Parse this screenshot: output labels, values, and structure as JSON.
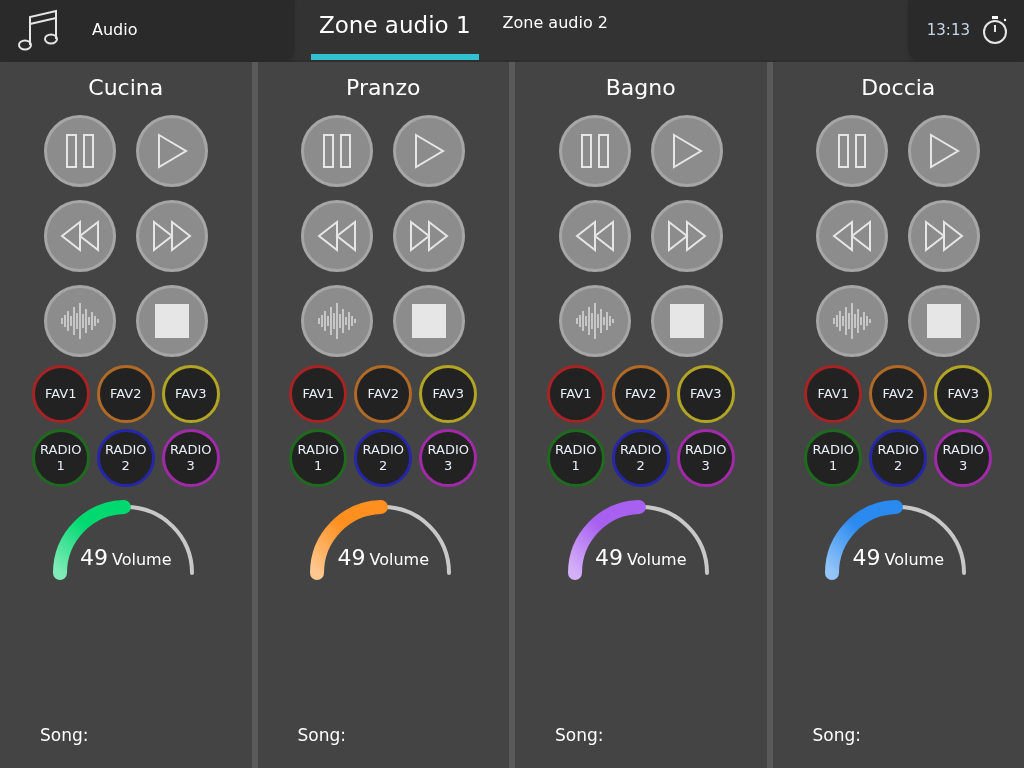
{
  "header": {
    "app": {
      "label": "Audio"
    },
    "tabs": [
      {
        "label": "Zone audio 1",
        "selected": true
      },
      {
        "label": "Zone audio 2",
        "selected": false
      }
    ],
    "clock": "13:13"
  },
  "zones": [
    {
      "name": "Cucina",
      "presets": [
        {
          "label": "FAV1",
          "color": "#a82323"
        },
        {
          "label": "FAV2",
          "color": "#b06a26"
        },
        {
          "label": "FAV3",
          "color": "#b2a524"
        },
        {
          "label": "RADIO 1",
          "color": "#1f6a1f"
        },
        {
          "label": "RADIO 2",
          "color": "#2626a8"
        },
        {
          "label": "RADIO 3",
          "color": "#a02aa8"
        }
      ],
      "volume": {
        "level": 0.49,
        "value": "49",
        "label": "Volume",
        "color": "#00d970"
      },
      "song": "Song:"
    },
    {
      "name": "Pranzo",
      "presets": [
        {
          "label": "FAV1",
          "color": "#a82323"
        },
        {
          "label": "FAV2",
          "color": "#b06a26"
        },
        {
          "label": "FAV3",
          "color": "#b2a524"
        },
        {
          "label": "RADIO 1",
          "color": "#1f6a1f"
        },
        {
          "label": "RADIO 2",
          "color": "#2626a8"
        },
        {
          "label": "RADIO 3",
          "color": "#a02aa8"
        }
      ],
      "volume": {
        "level": 0.49,
        "value": "49",
        "label": "Volume",
        "color": "#ff9020"
      },
      "song": "Song:"
    },
    {
      "name": "Bagno",
      "presets": [
        {
          "label": "FAV1",
          "color": "#a82323"
        },
        {
          "label": "FAV2",
          "color": "#b06a26"
        },
        {
          "label": "FAV3",
          "color": "#b2a524"
        },
        {
          "label": "RADIO 1",
          "color": "#1f6a1f"
        },
        {
          "label": "RADIO 2",
          "color": "#2626a8"
        },
        {
          "label": "RADIO 3",
          "color": "#a02aa8"
        }
      ],
      "volume": {
        "level": 0.49,
        "value": "49",
        "label": "Volume",
        "color": "#a860f0"
      },
      "song": "Song:"
    },
    {
      "name": "Doccia",
      "presets": [
        {
          "label": "FAV1",
          "color": "#a82323"
        },
        {
          "label": "FAV2",
          "color": "#b06a26"
        },
        {
          "label": "FAV3",
          "color": "#b2a524"
        },
        {
          "label": "RADIO 1",
          "color": "#1f6a1f"
        },
        {
          "label": "RADIO 2",
          "color": "#2626a8"
        },
        {
          "label": "RADIO 3",
          "color": "#a02aa8"
        }
      ],
      "volume": {
        "level": 0.49,
        "value": "49",
        "label": "Volume",
        "color": "#2a8af0"
      },
      "song": "Song:"
    }
  ]
}
